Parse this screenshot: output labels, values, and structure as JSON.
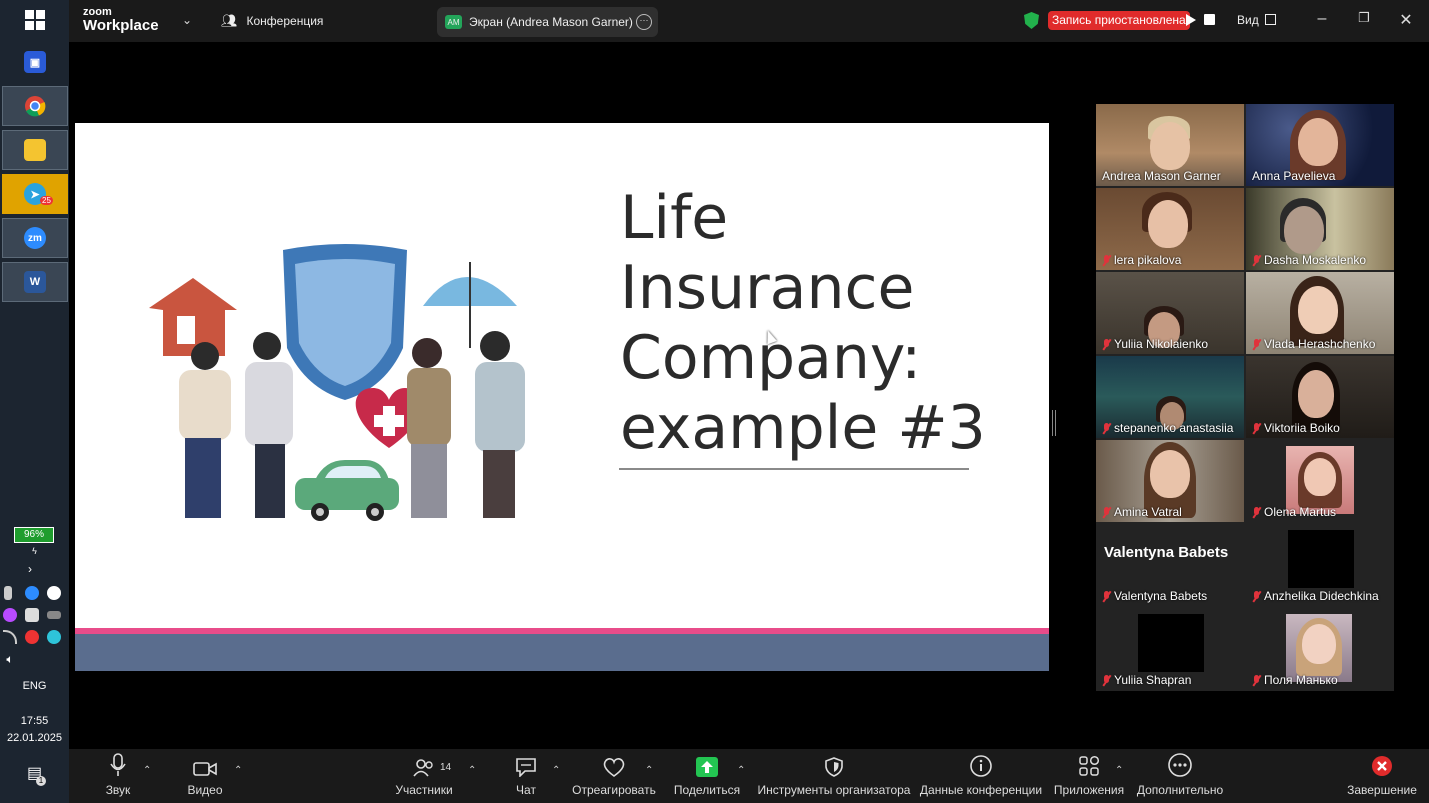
{
  "taskbar": {
    "battery": "96%",
    "language": "ENG",
    "time": "17:55",
    "date": "22.01.2025",
    "telegram_badge": "25",
    "notif_count": "1",
    "zoom_icon_label": "zm",
    "word_icon_label": "W"
  },
  "topbar": {
    "logo_top": "zoom",
    "logo_bottom": "Workplace",
    "conference_label": "Конференция",
    "screen_share_label": "Экран (Andrea Mason Garner)",
    "screen_share_badge": "AM",
    "recording_status": "Запись приостановлена",
    "view_label": "Вид"
  },
  "slide": {
    "title": "Life\nInsurance\nCompany:\nexample #3"
  },
  "gallery": {
    "tiles": [
      {
        "name": "Andrea Mason Garner",
        "muted": false
      },
      {
        "name": "Anna Pavelieva",
        "muted": false
      },
      {
        "name": "lera pikalova",
        "muted": true
      },
      {
        "name": "Dasha Moskalenko",
        "muted": true
      },
      {
        "name": "Yuliia Nikolaienko",
        "muted": true
      },
      {
        "name": "Vlada Herashchenko",
        "muted": true
      },
      {
        "name": "stepanenko anastasiia",
        "muted": true
      },
      {
        "name": "Viktoriia Boiko",
        "muted": true
      },
      {
        "name": "Amina Vatral",
        "muted": true
      },
      {
        "name": "Olena Martus",
        "muted": true
      },
      {
        "name": "Valentyna Babets",
        "muted": true,
        "avatar_text": "Valentyna Babets"
      },
      {
        "name": "Anzhelika Didechkina",
        "muted": true
      },
      {
        "name": "Yuliia Shapran",
        "muted": true
      },
      {
        "name": "Поля Манько",
        "muted": true
      }
    ]
  },
  "toolbar": {
    "audio": "Звук",
    "video": "Видео",
    "participants": "Участники",
    "participants_count": "14",
    "chat": "Чат",
    "react": "Отреагировать",
    "share": "Поделиться",
    "host_tools": "Инструменты организатора",
    "meeting_info": "Данные конференции",
    "apps": "Приложения",
    "more": "Дополнительно",
    "end": "Завершение"
  },
  "colors": {
    "speaking_outline": "#27d06a",
    "recording_red": "#e02b2b",
    "share_green": "#23c552",
    "slide_pink": "#e84c8a",
    "slide_blue": "#5a6d8e"
  }
}
